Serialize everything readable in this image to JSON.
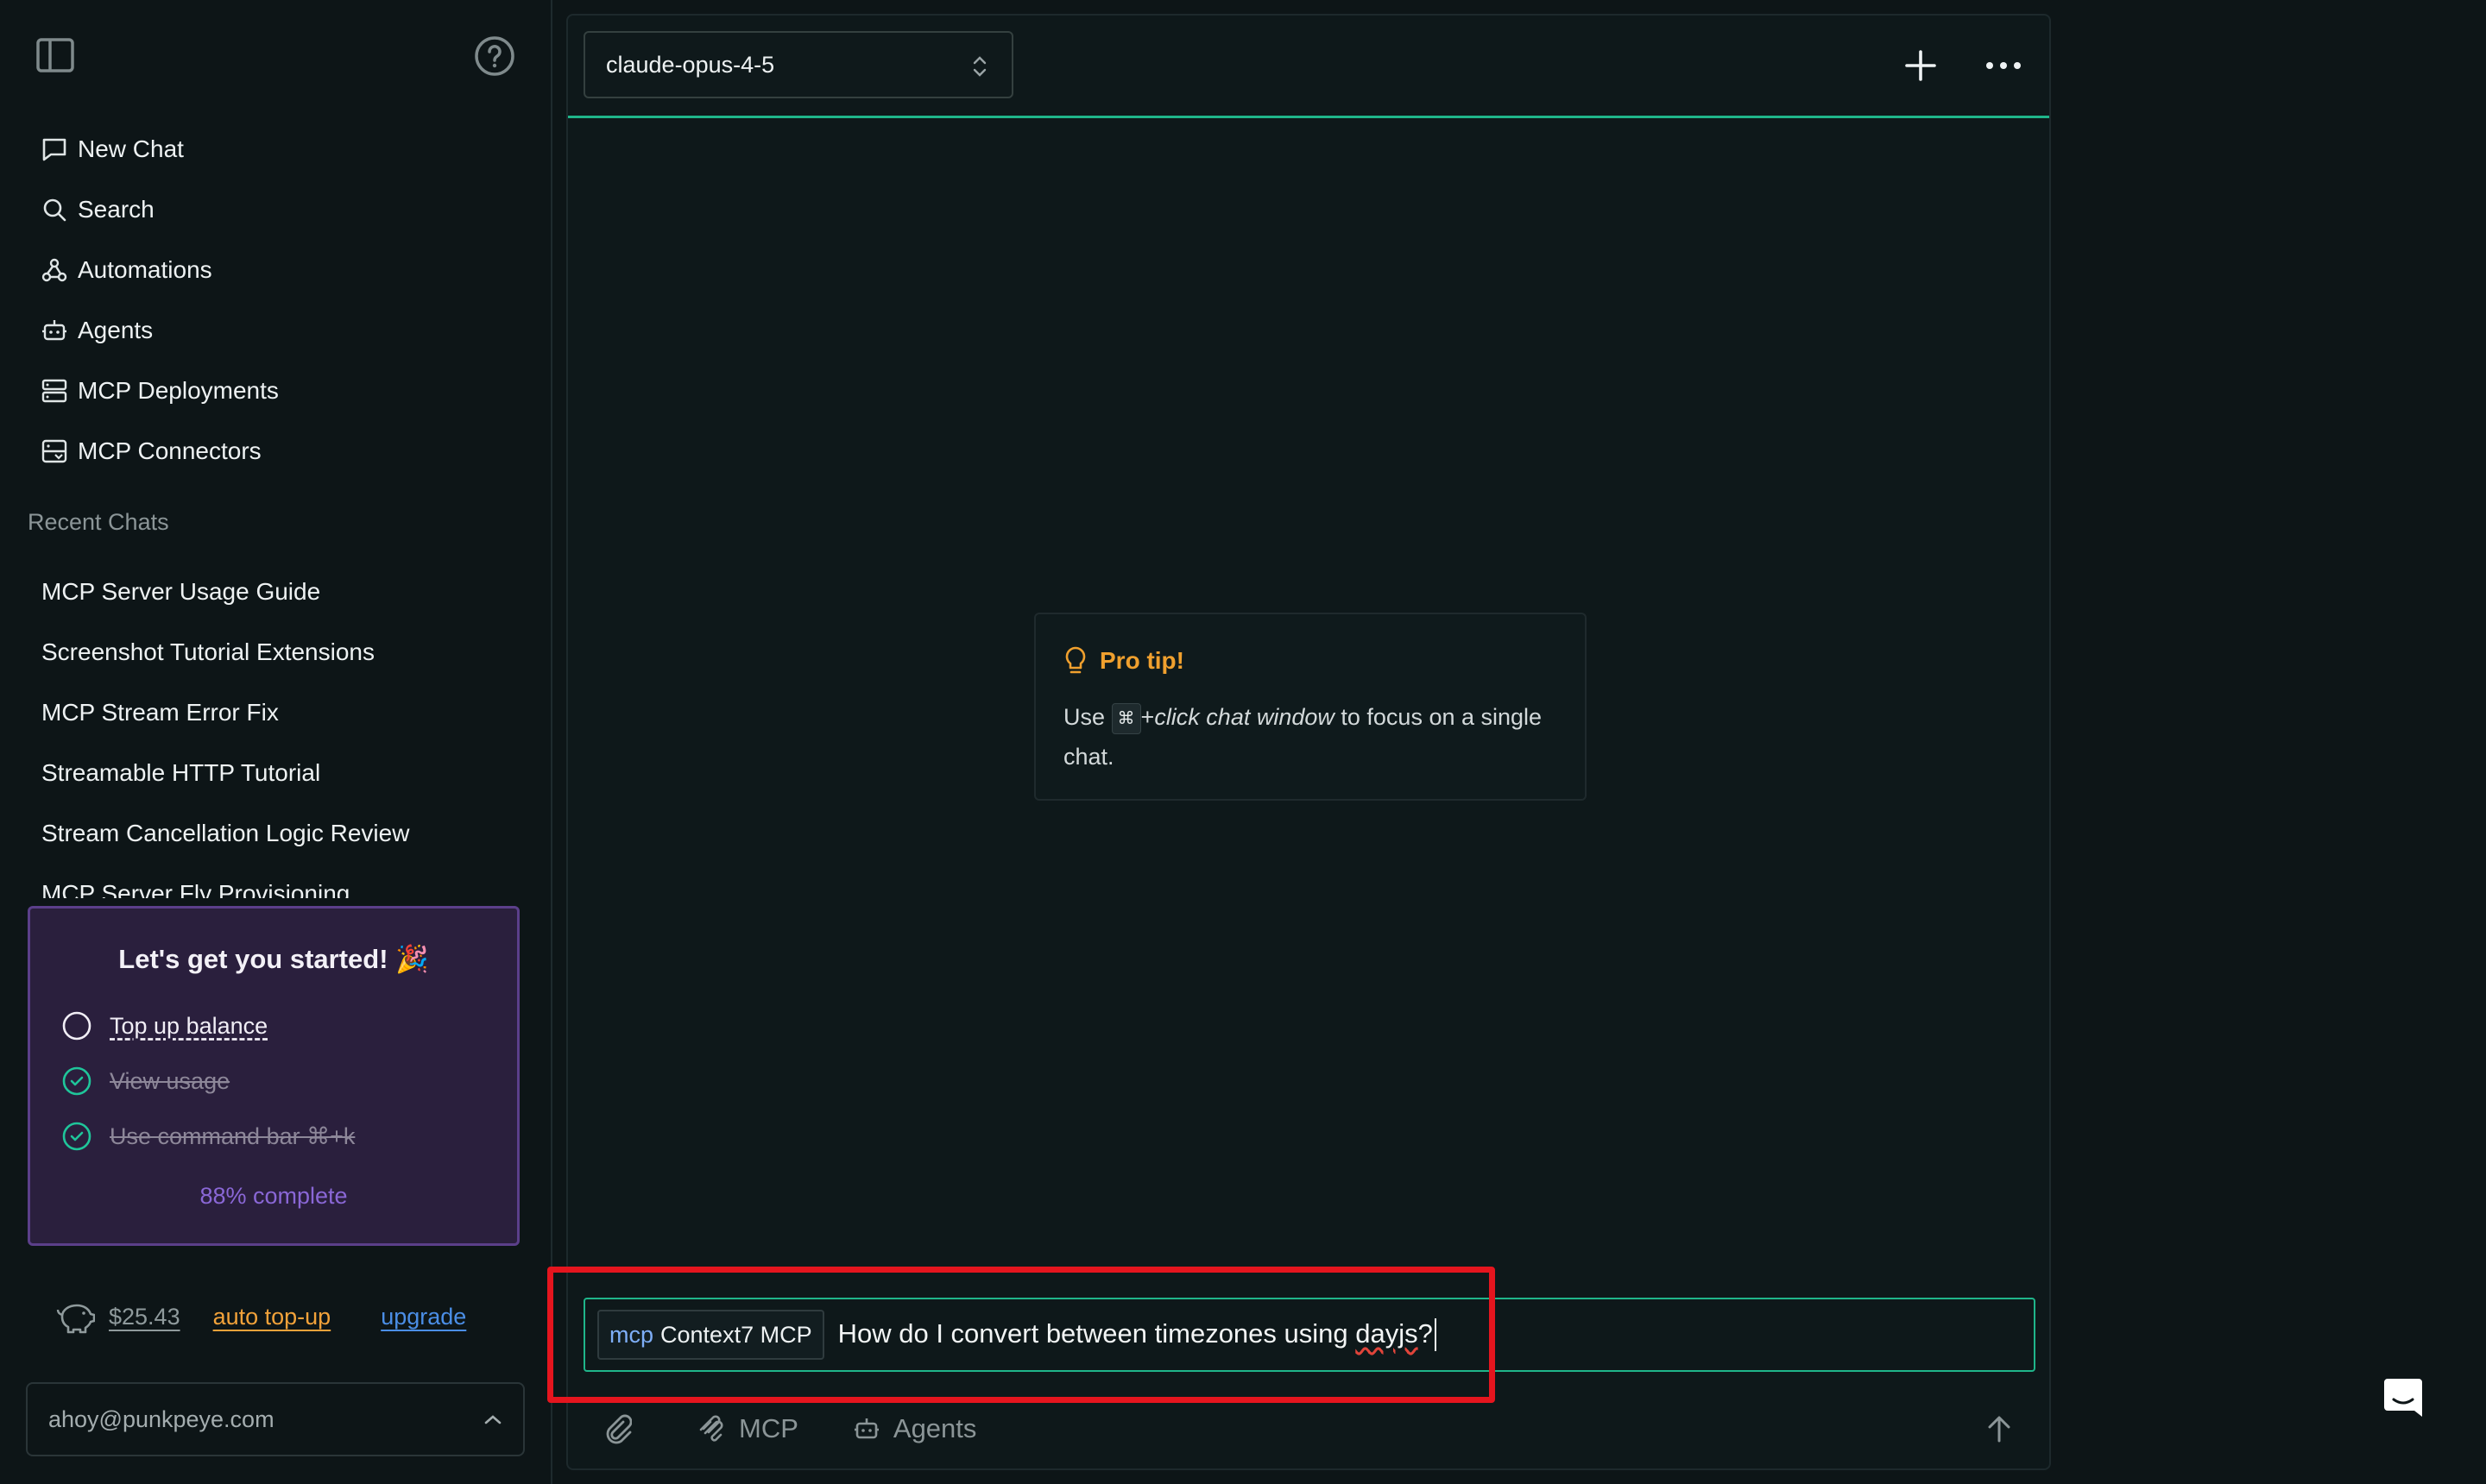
{
  "sidebar": {
    "nav": [
      {
        "label": "New Chat",
        "icon": "chat-bubble-icon"
      },
      {
        "label": "Search",
        "icon": "search-icon"
      },
      {
        "label": "Automations",
        "icon": "webhook-icon"
      },
      {
        "label": "Agents",
        "icon": "bot-icon"
      },
      {
        "label": "MCP Deployments",
        "icon": "server-icon"
      },
      {
        "label": "MCP Connectors",
        "icon": "connector-icon"
      }
    ],
    "recent_heading": "Recent Chats",
    "recent": [
      "MCP Server Usage Guide",
      "Screenshot Tutorial Extensions",
      "MCP Stream Error Fix",
      "Streamable HTTP Tutorial",
      "Stream Cancellation Logic Review",
      "MCP Server Fly Provisioning"
    ],
    "onboarding": {
      "title": "Let's get you started! 🎉",
      "tasks": [
        {
          "label": "Top up balance",
          "done": false
        },
        {
          "label": "View usage",
          "done": true
        },
        {
          "label": "Use command bar ⌘+k",
          "done": true
        }
      ],
      "progress_text": "88% complete",
      "progress": 0.88
    },
    "balance": "$25.43",
    "auto_topup": "auto top-up",
    "upgrade": "upgrade",
    "account_email": "ahoy@punkpeye.com"
  },
  "chat": {
    "model": "claude-opus-4-5",
    "tip": {
      "title": "Pro tip!",
      "use": "Use",
      "key": "⌘",
      "plus": "+",
      "action": "click chat window",
      "rest": " to focus on a single chat."
    },
    "input": {
      "chip_kind": "mcp",
      "chip_name": "Context7 MCP",
      "text_before": "How do I convert between timezones using ",
      "text_misspelled": "dayjs",
      "text_after": "?"
    },
    "tools": {
      "mcp": "MCP",
      "agents": "Agents"
    }
  },
  "colors": {
    "accent": "#1fb58a",
    "highlight": "#e5151e",
    "tip": "#f0a02e",
    "onboarding_bg": "#2a1f3d",
    "onboarding_border": "#5b3f8a",
    "autotop": "#f2a23a",
    "upgrade": "#4b8ee6"
  }
}
